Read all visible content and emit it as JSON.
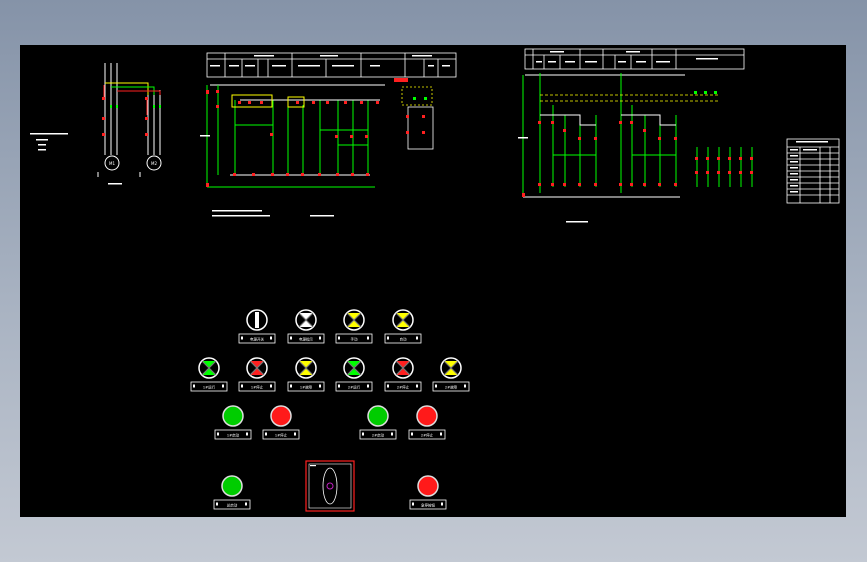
{
  "colors": {
    "background": "#000000",
    "wire_green": "#00ff00",
    "wire_white": "#ffffff",
    "wire_yellow": "#ffff00",
    "wire_red": "#ff2020",
    "frame_red": "#ff2020",
    "selector_marker": "#c020c0"
  },
  "main_circuit": {
    "motors": [
      "M1",
      "M2"
    ]
  },
  "panel": {
    "row1": [
      {
        "kind": "selector",
        "label": "电源开关"
      },
      {
        "kind": "white",
        "label": "电源指示"
      },
      {
        "kind": "yellow",
        "label": "手动"
      },
      {
        "kind": "yellow",
        "label": "自动"
      }
    ],
    "row2": [
      {
        "kind": "green",
        "label": "1#运行"
      },
      {
        "kind": "red",
        "label": "1#停止"
      },
      {
        "kind": "yellow",
        "label": "1#故障"
      },
      {
        "kind": "green",
        "label": "2#运行"
      },
      {
        "kind": "red",
        "label": "2#停止"
      },
      {
        "kind": "yellow",
        "label": "2#故障"
      }
    ],
    "row3": [
      {
        "kind": "btn-green",
        "label": "1#启动"
      },
      {
        "kind": "btn-red",
        "label": "1#停止"
      },
      {
        "kind": "btn-green",
        "label": "2#启动"
      },
      {
        "kind": "btn-red",
        "label": "2#停止"
      }
    ],
    "row4": [
      {
        "kind": "btn-green",
        "label": "总启动"
      },
      {
        "kind": "btn-red",
        "label": "急停按钮"
      }
    ]
  }
}
